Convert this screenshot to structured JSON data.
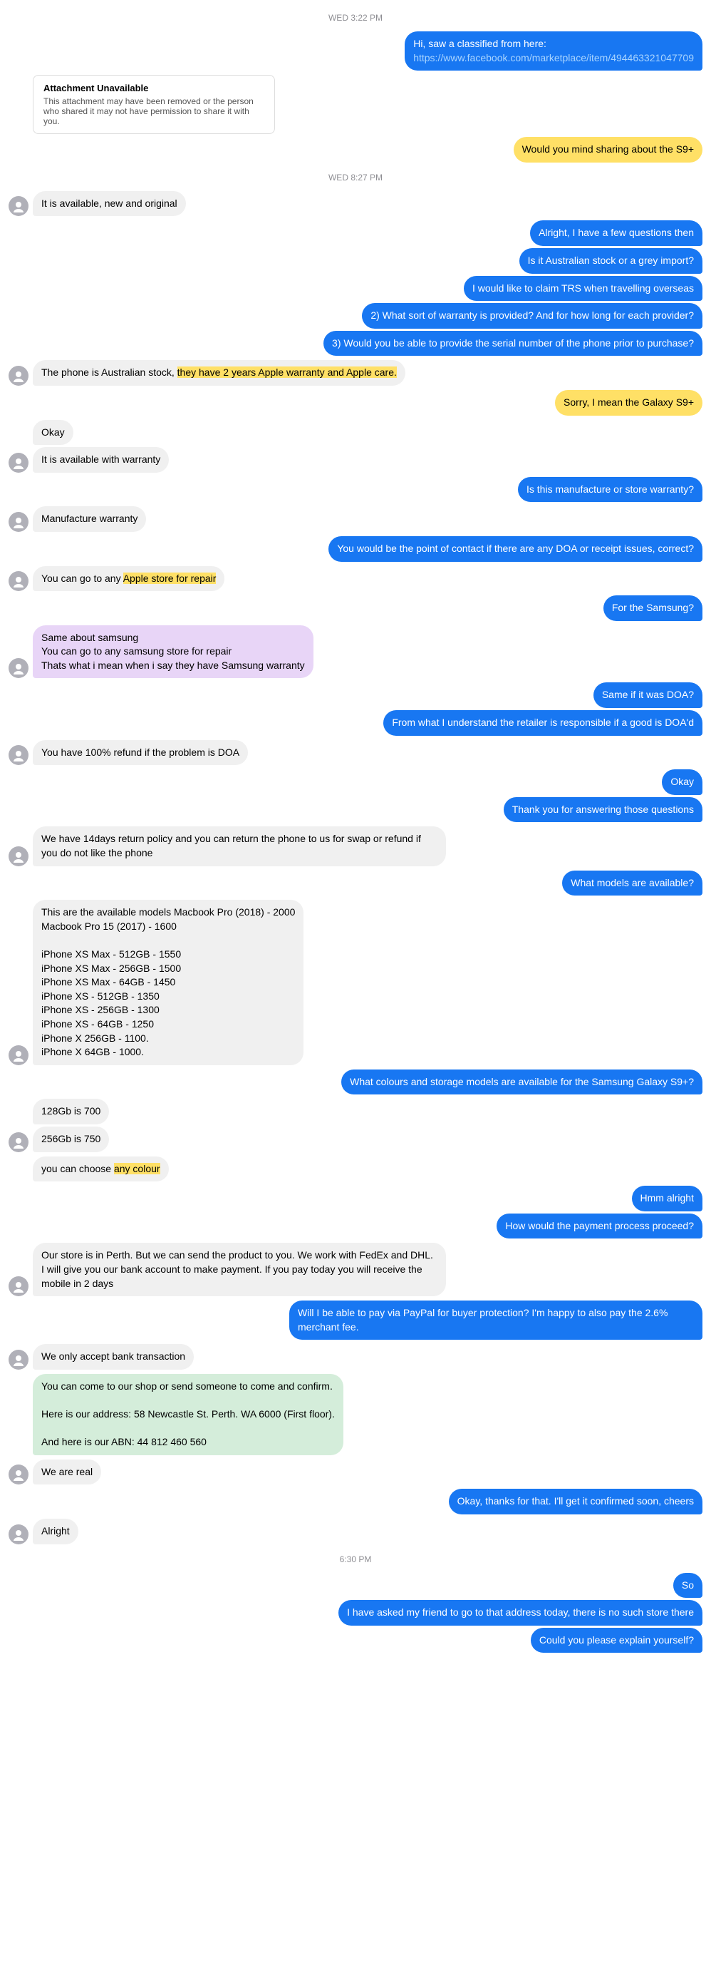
{
  "chat": {
    "timestamps": {
      "wed322": "WED 3:22 PM",
      "wed827": "WED 8:27 PM",
      "time630": "6:30 PM"
    },
    "messages": [
      {
        "id": "m1",
        "type": "outgoing",
        "text": "Hi, saw a classified from here:\nhttps://www.facebook.com/marketplace/item/494463321047709"
      },
      {
        "id": "m2",
        "type": "attachment",
        "title": "Attachment Unavailable",
        "desc": "This attachment may have been removed or the person who shared it may not have permission to share it with you."
      },
      {
        "id": "m3",
        "type": "outgoing",
        "text": "Would you mind sharing about the S9+"
      },
      {
        "id": "m4",
        "type": "incoming",
        "text": "It is available, new and original"
      },
      {
        "id": "m5",
        "type": "outgoing-multi",
        "texts": [
          "Alright, I have a few questions then",
          "Is it Australian stock or a grey import?",
          "I would like to claim TRS when travelling overseas",
          "2) What sort of warranty is provided? And for how long for each provider?",
          "3) Would you be able to provide the serial number of the phone prior to purchase?"
        ]
      },
      {
        "id": "m6",
        "type": "incoming-highlight",
        "text_parts": [
          {
            "text": "The phone is Australian stock, ",
            "highlight": false
          },
          {
            "text": "they have 2 years Apple warranty and Apple care.",
            "highlight": true,
            "color": "yellow"
          }
        ]
      },
      {
        "id": "m7",
        "type": "outgoing",
        "text": "Sorry, I mean the Galaxy S9+"
      },
      {
        "id": "m8",
        "type": "incoming-multi",
        "texts": [
          "Okay",
          "It is available with warranty"
        ]
      },
      {
        "id": "m9",
        "type": "outgoing",
        "text": "Is this manufacture or store warranty?"
      },
      {
        "id": "m10",
        "type": "incoming",
        "text": "Manufacture warranty"
      },
      {
        "id": "m11",
        "type": "outgoing",
        "text": "You would be the point of contact if there are any DOA or receipt issues, correct?"
      },
      {
        "id": "m12",
        "type": "incoming-highlight2",
        "text_parts": [
          {
            "text": "You can go to any ",
            "highlight": false
          },
          {
            "text": "Apple store for repair",
            "highlight": true,
            "color": "yellow"
          }
        ]
      },
      {
        "id": "m13",
        "type": "outgoing",
        "text": "For the Samsung?"
      },
      {
        "id": "m14",
        "type": "incoming-purple",
        "texts": [
          "Same about samsung",
          "You can go to any samsung store for repair",
          "Thats what i mean when i say they have Samsung warranty"
        ]
      },
      {
        "id": "m15",
        "type": "outgoing-multi",
        "texts": [
          "Same if it was DOA?",
          "From what I understand the retailer is responsible if a good is DOA'd"
        ]
      },
      {
        "id": "m16",
        "type": "incoming",
        "text": "You have 100% refund if the problem is DOA"
      },
      {
        "id": "m17",
        "type": "outgoing-multi",
        "texts": [
          "Okay",
          "Thank you for answering those questions"
        ]
      },
      {
        "id": "m18",
        "type": "incoming",
        "text": "We have 14days return policy and you can return the phone to us for swap or refund if you do not like the phone"
      },
      {
        "id": "m19",
        "type": "outgoing",
        "text": "What models are available?"
      },
      {
        "id": "m20",
        "type": "incoming-list",
        "text": "This are the available models Macbook Pro (2018) - 2000\nMacbook Pro 15 (2017) - 1600\n\niPhone XS Max - 512GB - 1550\niPhone XS Max - 256GB - 1500\niPhone XS Max - 64GB - 1450\niPhone XS - 512GB - 1350\niPhone XS - 256GB - 1300\niPhone XS - 64GB - 1250\niPhone X 256GB - 1100.\niPhone X 64GB - 1000."
      },
      {
        "id": "m21",
        "type": "outgoing",
        "text": "What colours and storage models are available for the Samsung Galaxy S9+?"
      },
      {
        "id": "m22",
        "type": "incoming-multi",
        "texts": [
          "128Gb is 700",
          "256Gb is 750"
        ]
      },
      {
        "id": "m23",
        "type": "incoming-highlight3",
        "text_parts": [
          {
            "text": "you can choose ",
            "highlight": false
          },
          {
            "text": "any colour",
            "highlight": true,
            "color": "yellow"
          }
        ]
      },
      {
        "id": "m24",
        "type": "outgoing-multi",
        "texts": [
          "Hmm alright",
          "How would the payment process proceed?"
        ]
      },
      {
        "id": "m25",
        "type": "incoming",
        "text": "Our store is in Perth. But we can send the product to you. We work with FedEx and DHL.\nI will give you our bank account to make payment. If you pay today you will receive the mobile in 2 days"
      },
      {
        "id": "m26",
        "type": "outgoing",
        "text": "Will I be able to pay via PayPal for buyer protection? I'm happy to also pay the 2.6% merchant fee."
      },
      {
        "id": "m27",
        "type": "incoming",
        "text": "We only accept bank transaction"
      },
      {
        "id": "m28",
        "type": "incoming-green",
        "texts": [
          "You can come to our shop or send someone to come and confirm.",
          "Here is our address: 58 Newcastle St. Perth. WA 6000 (First floor).",
          "And here is our ABN: 44 812 460 560",
          "We are real"
        ]
      },
      {
        "id": "m29",
        "type": "outgoing",
        "text": "Okay, thanks for that. I'll get it confirmed soon, cheers"
      },
      {
        "id": "m30",
        "type": "incoming",
        "text": "Alright"
      },
      {
        "id": "m31",
        "type": "outgoing-multi",
        "texts": [
          "So",
          "I have asked my friend to go to that address today, there is no such store there",
          "Could you please explain yourself?"
        ]
      }
    ]
  }
}
